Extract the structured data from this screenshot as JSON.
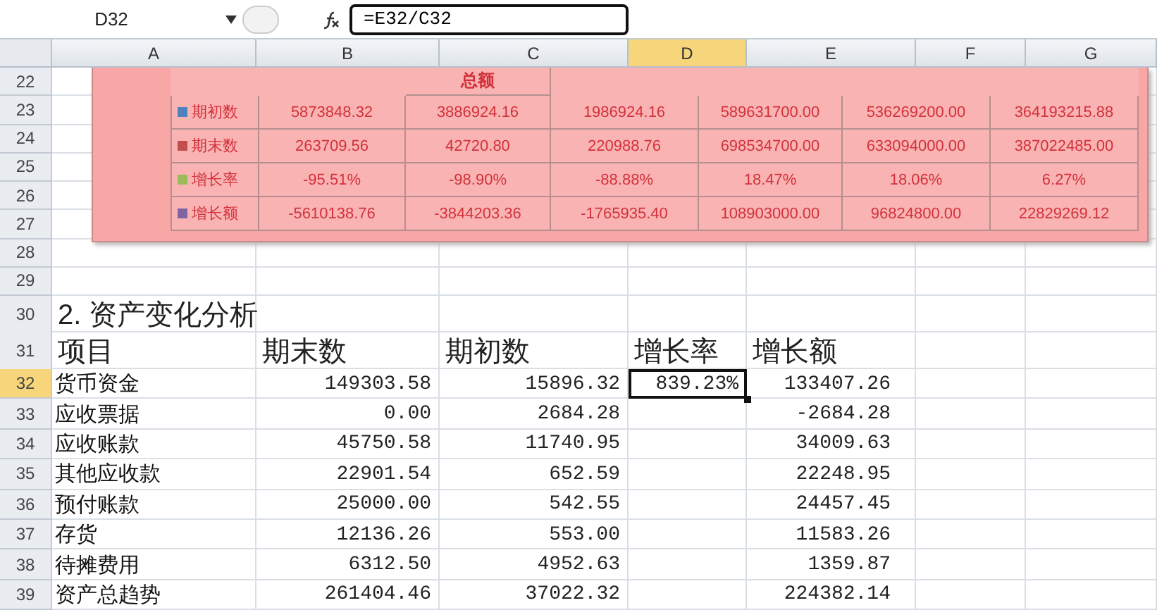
{
  "formula_bar": {
    "name_box": "D32",
    "formula": "=E32/C32"
  },
  "columns": [
    {
      "label": "A",
      "selected": false
    },
    {
      "label": "B",
      "selected": false
    },
    {
      "label": "C",
      "selected": false
    },
    {
      "label": "D",
      "selected": true
    },
    {
      "label": "E",
      "selected": false
    },
    {
      "label": "F",
      "selected": false
    },
    {
      "label": "G",
      "selected": false
    }
  ],
  "row_headers": [
    {
      "label": "22",
      "selected": false
    },
    {
      "label": "23",
      "selected": false
    },
    {
      "label": "24",
      "selected": false
    },
    {
      "label": "25",
      "selected": false
    },
    {
      "label": "26",
      "selected": false
    },
    {
      "label": "27",
      "selected": false
    },
    {
      "label": "28",
      "selected": false
    },
    {
      "label": "29",
      "selected": false
    },
    {
      "label": "30",
      "selected": false
    },
    {
      "label": "31",
      "selected": false
    },
    {
      "label": "32",
      "selected": true
    },
    {
      "label": "33",
      "selected": false
    },
    {
      "label": "34",
      "selected": false
    },
    {
      "label": "35",
      "selected": false
    },
    {
      "label": "36",
      "selected": false
    },
    {
      "label": "37",
      "selected": false
    },
    {
      "label": "38",
      "selected": false
    },
    {
      "label": "39",
      "selected": false
    }
  ],
  "chart_table": {
    "partial_header": "总额",
    "rows": [
      {
        "label": "期初数",
        "color": "#4f81bd",
        "values": [
          "5873848.32",
          "3886924.16",
          "1986924.16",
          "589631700.00",
          "536269200.00",
          "364193215.88"
        ]
      },
      {
        "label": "期末数",
        "color": "#c0504d",
        "values": [
          "263709.56",
          "42720.80",
          "220988.76",
          "698534700.00",
          "633094000.00",
          "387022485.00"
        ]
      },
      {
        "label": "增长率",
        "color": "#9bbb59",
        "values": [
          "-95.51%",
          "-98.90%",
          "-88.88%",
          "18.47%",
          "18.06%",
          "6.27%"
        ]
      },
      {
        "label": "增长额",
        "color": "#8064a2",
        "values": [
          "-5610138.76",
          "-3844203.36",
          "-1765935.40",
          "108903000.00",
          "96824800.00",
          "22829269.12"
        ]
      }
    ]
  },
  "analysis": {
    "title": "2. 资产变化分析",
    "columns": [
      "项目",
      "期末数",
      "期初数",
      "增长率",
      "增长额"
    ],
    "rows": [
      {
        "item": "货币资金",
        "end": "149303.58",
        "begin": "15896.32",
        "rate": "839.23%",
        "selected": true,
        "amount": "133407.26"
      },
      {
        "item": "应收票据",
        "end": "0.00",
        "begin": "2684.28",
        "selected": false,
        "amount": "-2684.28"
      },
      {
        "item": "应收账款",
        "end": "45750.58",
        "begin": "11740.95",
        "selected": false,
        "amount": "34009.63"
      },
      {
        "item": "其他应收款",
        "end": "22901.54",
        "begin": "652.59",
        "selected": false,
        "amount": "22248.95"
      },
      {
        "item": "预付账款",
        "end": "25000.00",
        "begin": "542.55",
        "selected": false,
        "amount": "24457.45"
      },
      {
        "item": "存货",
        "end": "12136.26",
        "begin": "553.00",
        "selected": false,
        "amount": "11583.26"
      },
      {
        "item": "待摊费用",
        "end": "6312.50",
        "begin": "4952.63",
        "selected": false,
        "amount": "1359.87"
      },
      {
        "item": "资产总趋势",
        "end": "261404.46",
        "begin": "37022.32",
        "selected": false,
        "amount": "224382.14"
      }
    ]
  }
}
